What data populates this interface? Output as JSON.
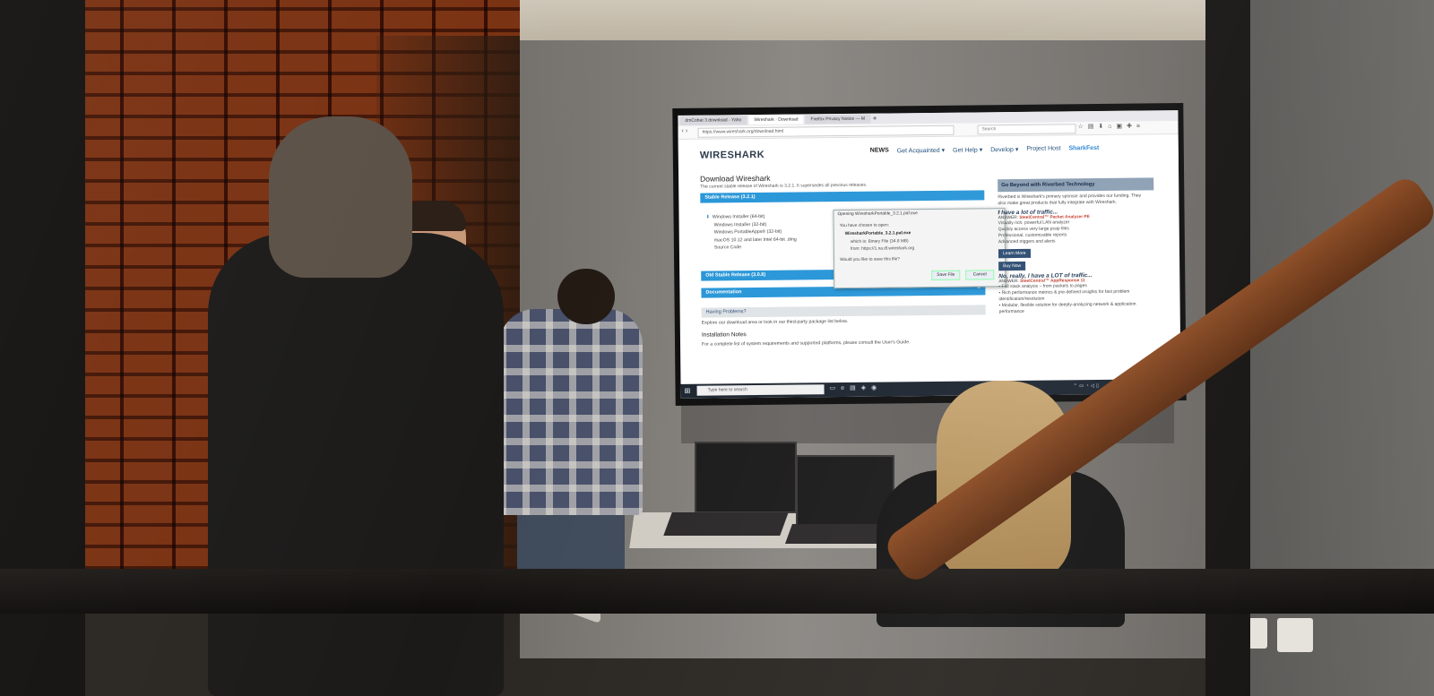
{
  "browser": {
    "tabs": [
      "dmCohat 3 download - Yaho",
      "Wireshark · Download",
      "Firefox Privacy Notice — M"
    ],
    "new_tab": "+",
    "url": "https://www.wireshark.org/download.html",
    "search_placeholder": "Search"
  },
  "site": {
    "logo": "WIRESHARK",
    "nav": [
      "NEWS",
      "Get Acquainted ▾",
      "Get Help ▾",
      "Develop ▾",
      "Project Host",
      "SharkFest"
    ]
  },
  "main": {
    "title": "Download Wireshark",
    "lead": "The current stable release of Wireshark is 3.2.1. It supersedes all previous releases.",
    "stable_bar": "Stable Release (3.2.1)",
    "downloads": [
      "Windows Installer (64-bit)",
      "Windows Installer (32-bit)",
      "Windows PortableApps® (32-bit)",
      "macOS 10.12 and later Intel 64-bit .dmg",
      "Source Code"
    ],
    "old_stable_bar": "Old Stable Release (3.0.8)",
    "documentation_bar": "Documentation",
    "problems_bar": "Having Problems?",
    "problems_text": "Explore our download area or look in our third-party package list below.",
    "install_heading": "Installation Notes",
    "install_text": "For a complete list of system requirements and supported platforms, please consult the User's Guide."
  },
  "dialog": {
    "title": "Opening WiresharkPortable_3.2.1.paf.exe",
    "chosen_label": "You have chosen to open:",
    "file_name": "WiresharkPortable_3.2.1.paf.exe",
    "which_is": "which is: Binary File (34.8 MB)",
    "from": "from: https://1.na.dl.wireshark.org",
    "question": "Would you like to save this file?",
    "save_button": "Save File",
    "cancel_button": "Cancel"
  },
  "sidebar": {
    "heading": "Go Beyond with Riverbed Technology",
    "intro": "Riverbed is Wireshark's primary sponsor and provides our funding. They also make great products that fully integrate with Wireshark.",
    "subhead1": "I have a lot of traffic...",
    "answer1_prefix": "ANSWER:",
    "answer1": "SteelCentral™ Packet Analyzer PE",
    "list1": [
      "Visually rich, powerful LAN analyzer",
      "Quickly access very large pcap files",
      "Professional, customizable reports",
      "Advanced triggers and alerts"
    ],
    "learn_more": "Learn More",
    "buy_now": "Buy Now",
    "subhead2": "No, really, I have a LOT of traffic...",
    "answer2_prefix": "ANSWER:",
    "answer2": "SteelCentral™ AppResponse 11",
    "list2": [
      "• Full stack analysis – from packets to pages",
      "• Rich performance metrics & pre-defined insights for fast problem identification/resolution",
      "• Modular, flexible solution for deeply-analyzing network & application performance"
    ]
  },
  "taskbar": {
    "search_placeholder": "Type here to search",
    "time": "10:19 AM",
    "date": "2/3/2020"
  }
}
